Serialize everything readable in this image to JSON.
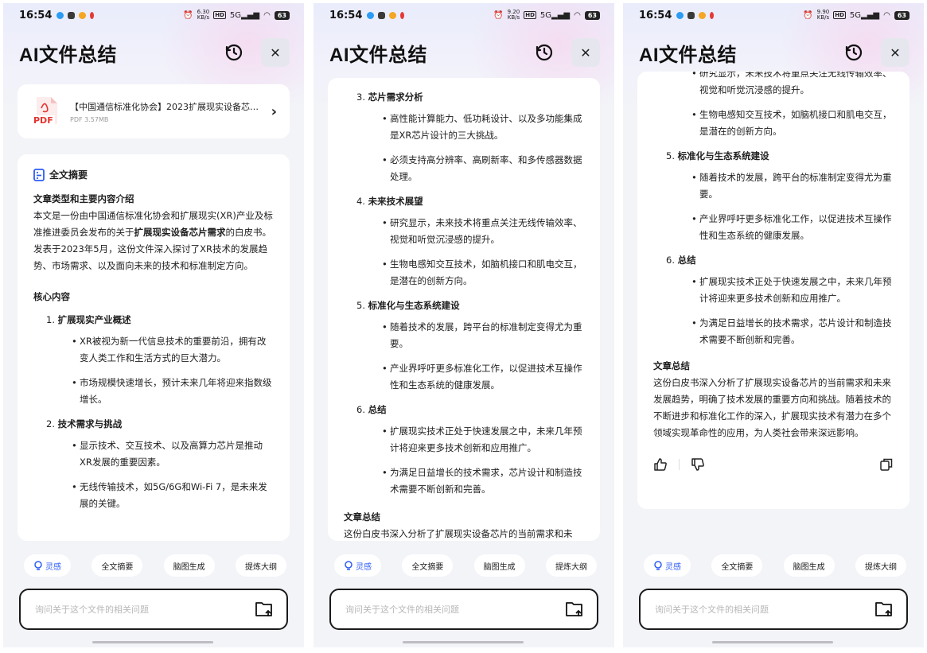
{
  "screens": [
    {
      "status": {
        "time": "16:54",
        "speed_top": "6.30",
        "speed_bottom": "KB/s",
        "hd": "HD",
        "network": "5G",
        "battery": "63"
      },
      "header": {
        "title": "AI文件总结"
      },
      "file": {
        "title": "【中国通信标准化协会】2023扩展现实设备芯…",
        "meta": "PDF 3.57MB",
        "icon_label": "PDF"
      },
      "summary": {
        "heading": "全文摘要",
        "type_title": "文章类型和主要内容介绍",
        "intro_before": "本文是一份由中国通信标准化协会和扩展现实(XR)产业及标准推进委员会发布的关于",
        "intro_bold": "扩展现实设备芯片需求",
        "intro_after": "的白皮书。发表于2023年5月，这份文件深入探讨了XR技术的发展趋势、市场需求、以及面向未来的技术和标准制定方向。",
        "core_title": "核心内容",
        "sections": [
          {
            "num": "1.",
            "title": "扩展现实产业概述",
            "bullets": [
              "XR被视为新一代信息技术的重要前沿，拥有改变人类工作和生活方式的巨大潜力。",
              "市场规模快速增长，预计未来几年将迎来指数级增长。"
            ]
          },
          {
            "num": "2.",
            "title": "技术需求与挑战",
            "bullets": [
              "显示技术、交互技术、以及高算力芯片是推动XR发展的重要因素。",
              "无线传输技术，如5G/6G和Wi-Fi 7，是未来发展的关键。"
            ]
          }
        ]
      },
      "chips": [
        "灵感",
        "全文摘要",
        "脑图生成",
        "提炼大纲"
      ],
      "input": {
        "placeholder": "询问关于这个文件的相关问题"
      }
    },
    {
      "status": {
        "time": "16:54",
        "speed_top": "9.20",
        "speed_bottom": "KB/s",
        "hd": "HD",
        "network": "5G",
        "battery": "63"
      },
      "header": {
        "title": "AI文件总结"
      },
      "sections": [
        {
          "num": "3.",
          "title": "芯片需求分析",
          "bullets": [
            "高性能计算能力、低功耗设计、以及多功能集成是XR芯片设计的三大挑战。",
            "必须支持高分辨率、高刷新率、和多传感器数据处理。"
          ]
        },
        {
          "num": "4.",
          "title": "未来技术展望",
          "bullets": [
            "研究显示，未来技术将重点关注无线传输效率、视觉和听觉沉浸感的提升。",
            "生物电感知交互技术，如脑机接口和肌电交互，是潜在的创新方向。"
          ]
        },
        {
          "num": "5.",
          "title": "标准化与生态系统建设",
          "bullets": [
            "随着技术的发展，跨平台的标准制定变得尤为重要。",
            "产业界呼吁更多标准化工作，以促进技术互操作性和生态系统的健康发展。"
          ]
        },
        {
          "num": "6.",
          "title": "总结",
          "bullets": [
            "扩展现实技术正处于快速发展之中，未来几年预计将迎来更多技术创新和应用推广。",
            "为满足日益增长的技术需求，芯片设计和制造技术需要不断创新和完善。"
          ]
        }
      ],
      "conclusion": {
        "title": "文章总结",
        "text": "这份白皮书深入分析了扩展现实设备芯片的当前需求和未"
      },
      "chips": [
        "灵感",
        "全文摘要",
        "脑图生成",
        "提炼大纲"
      ],
      "input": {
        "placeholder": "询问关于这个文件的相关问题"
      }
    },
    {
      "status": {
        "time": "16:54",
        "speed_top": "9.90",
        "speed_bottom": "KB/s",
        "hd": "HD",
        "network": "5G",
        "battery": "63"
      },
      "header": {
        "title": "AI文件总结"
      },
      "top_bullets": [
        "研究显示，未来技术将重点关注无线传输效率、视觉和听觉沉浸感的提升。",
        "生物电感知交互技术，如脑机接口和肌电交互，是潜在的创新方向。"
      ],
      "sections": [
        {
          "num": "5.",
          "title": "标准化与生态系统建设",
          "bullets": [
            "随着技术的发展，跨平台的标准制定变得尤为重要。",
            "产业界呼吁更多标准化工作，以促进技术互操作性和生态系统的健康发展。"
          ]
        },
        {
          "num": "6.",
          "title": "总结",
          "bullets": [
            "扩展现实技术正处于快速发展之中，未来几年预计将迎来更多技术创新和应用推广。",
            "为满足日益增长的技术需求，芯片设计和制造技术需要不断创新和完善。"
          ]
        }
      ],
      "conclusion": {
        "title": "文章总结",
        "text": "这份白皮书深入分析了扩展现实设备芯片的当前需求和未来发展趋势，明确了技术发展的重要方向和挑战。随着技术的不断进步和标准化工作的深入，扩展现实技术有潜力在多个领域实现革命性的应用，为人类社会带来深远影响。"
      },
      "chips": [
        "灵感",
        "全文摘要",
        "脑图生成",
        "提炼大纲"
      ],
      "input": {
        "placeholder": "询问关于这个文件的相关问题"
      }
    }
  ],
  "colors": {
    "accent": "#2e5cf6",
    "pdf_red": "#e3342f",
    "notif_blue": "#2b9cf5",
    "notif_orange": "#f5a623",
    "notif_red": "#e53935"
  }
}
